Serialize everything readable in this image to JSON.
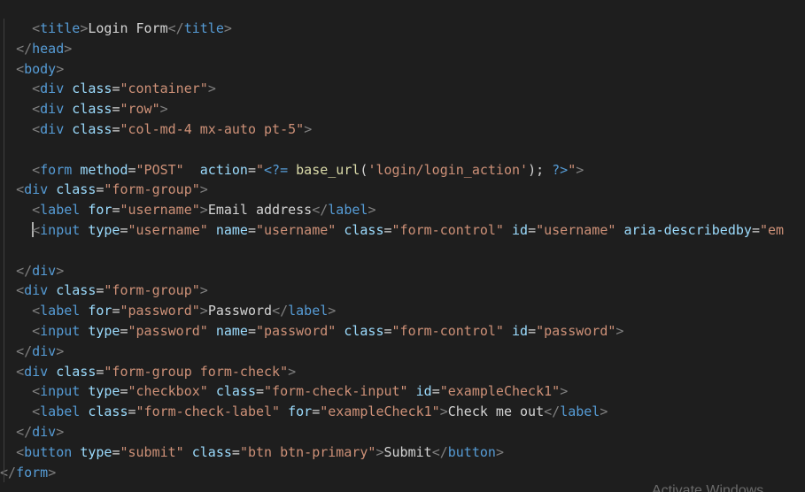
{
  "code_lines": [
    [
      {
        "c": "tk-text",
        "t": "    "
      },
      {
        "c": "tk-punct",
        "t": "<"
      },
      {
        "c": "tk-tag",
        "t": "title"
      },
      {
        "c": "tk-punct",
        "t": ">"
      },
      {
        "c": "tk-text",
        "t": "Login Form"
      },
      {
        "c": "tk-punct",
        "t": "</"
      },
      {
        "c": "tk-tag",
        "t": "title"
      },
      {
        "c": "tk-punct",
        "t": ">"
      }
    ],
    [
      {
        "c": "tk-text",
        "t": "  "
      },
      {
        "c": "tk-punct",
        "t": "</"
      },
      {
        "c": "tk-tag",
        "t": "head"
      },
      {
        "c": "tk-punct",
        "t": ">"
      }
    ],
    [
      {
        "c": "tk-text",
        "t": "  "
      },
      {
        "c": "tk-punct",
        "t": "<"
      },
      {
        "c": "tk-tag",
        "t": "body"
      },
      {
        "c": "tk-punct",
        "t": ">"
      }
    ],
    [
      {
        "c": "tk-text",
        "t": "    "
      },
      {
        "c": "tk-punct",
        "t": "<"
      },
      {
        "c": "tk-tag",
        "t": "div"
      },
      {
        "c": "tk-text",
        "t": " "
      },
      {
        "c": "tk-attr",
        "t": "class"
      },
      {
        "c": "tk-text",
        "t": "="
      },
      {
        "c": "tk-str",
        "t": "\"container\""
      },
      {
        "c": "tk-punct",
        "t": ">"
      }
    ],
    [
      {
        "c": "tk-text",
        "t": "    "
      },
      {
        "c": "tk-punct",
        "t": "<"
      },
      {
        "c": "tk-tag",
        "t": "div"
      },
      {
        "c": "tk-text",
        "t": " "
      },
      {
        "c": "tk-attr",
        "t": "class"
      },
      {
        "c": "tk-text",
        "t": "="
      },
      {
        "c": "tk-str",
        "t": "\"row\""
      },
      {
        "c": "tk-punct",
        "t": ">"
      }
    ],
    [
      {
        "c": "tk-text",
        "t": "    "
      },
      {
        "c": "tk-punct",
        "t": "<"
      },
      {
        "c": "tk-tag",
        "t": "div"
      },
      {
        "c": "tk-text",
        "t": " "
      },
      {
        "c": "tk-attr",
        "t": "class"
      },
      {
        "c": "tk-text",
        "t": "="
      },
      {
        "c": "tk-str",
        "t": "\"col-md-4 mx-auto pt-5\""
      },
      {
        "c": "tk-punct",
        "t": ">"
      }
    ],
    [],
    [
      {
        "c": "tk-text",
        "t": "    "
      },
      {
        "c": "tk-punct",
        "t": "<"
      },
      {
        "c": "tk-tag",
        "t": "form"
      },
      {
        "c": "tk-text",
        "t": " "
      },
      {
        "c": "tk-attr",
        "t": "method"
      },
      {
        "c": "tk-text",
        "t": "="
      },
      {
        "c": "tk-str",
        "t": "\"POST\""
      },
      {
        "c": "tk-text",
        "t": "  "
      },
      {
        "c": "tk-attr",
        "t": "action"
      },
      {
        "c": "tk-text",
        "t": "="
      },
      {
        "c": "tk-str",
        "t": "\""
      },
      {
        "c": "tk-php-delim",
        "t": "<?="
      },
      {
        "c": "tk-text",
        "t": " "
      },
      {
        "c": "tk-func",
        "t": "base_url"
      },
      {
        "c": "tk-text",
        "t": "("
      },
      {
        "c": "tk-str",
        "t": "'login/login_action'"
      },
      {
        "c": "tk-text",
        "t": "); "
      },
      {
        "c": "tk-php-delim",
        "t": "?>"
      },
      {
        "c": "tk-str",
        "t": "\""
      },
      {
        "c": "tk-punct",
        "t": ">"
      }
    ],
    [
      {
        "c": "tk-text",
        "t": "  "
      },
      {
        "c": "tk-punct",
        "t": "<"
      },
      {
        "c": "tk-tag",
        "t": "div"
      },
      {
        "c": "tk-text",
        "t": " "
      },
      {
        "c": "tk-attr",
        "t": "class"
      },
      {
        "c": "tk-text",
        "t": "="
      },
      {
        "c": "tk-str",
        "t": "\"form-group\""
      },
      {
        "c": "tk-punct",
        "t": ">"
      }
    ],
    [
      {
        "c": "tk-text",
        "t": "    "
      },
      {
        "c": "tk-punct",
        "t": "<"
      },
      {
        "c": "tk-tag",
        "t": "label"
      },
      {
        "c": "tk-text",
        "t": " "
      },
      {
        "c": "tk-attr",
        "t": "for"
      },
      {
        "c": "tk-text",
        "t": "="
      },
      {
        "c": "tk-str",
        "t": "\"username\""
      },
      {
        "c": "tk-punct",
        "t": ">"
      },
      {
        "c": "tk-text",
        "t": "Email address"
      },
      {
        "c": "tk-punct",
        "t": "</"
      },
      {
        "c": "tk-tag",
        "t": "label"
      },
      {
        "c": "tk-punct",
        "t": ">"
      }
    ],
    [
      {
        "c": "tk-text",
        "t": "    "
      },
      {
        "c": "cursor",
        "t": ""
      },
      {
        "c": "tk-punct",
        "t": "<"
      },
      {
        "c": "tk-tag",
        "t": "input"
      },
      {
        "c": "tk-text",
        "t": " "
      },
      {
        "c": "tk-attr",
        "t": "type"
      },
      {
        "c": "tk-text",
        "t": "="
      },
      {
        "c": "tk-str",
        "t": "\"username\""
      },
      {
        "c": "tk-text",
        "t": " "
      },
      {
        "c": "tk-attr",
        "t": "name"
      },
      {
        "c": "tk-text",
        "t": "="
      },
      {
        "c": "tk-str",
        "t": "\"username\""
      },
      {
        "c": "tk-text",
        "t": " "
      },
      {
        "c": "tk-attr",
        "t": "class"
      },
      {
        "c": "tk-text",
        "t": "="
      },
      {
        "c": "tk-str",
        "t": "\"form-control\""
      },
      {
        "c": "tk-text",
        "t": " "
      },
      {
        "c": "tk-attr",
        "t": "id"
      },
      {
        "c": "tk-text",
        "t": "="
      },
      {
        "c": "tk-str",
        "t": "\"username\""
      },
      {
        "c": "tk-text",
        "t": " "
      },
      {
        "c": "tk-attr",
        "t": "aria-describedby"
      },
      {
        "c": "tk-text",
        "t": "="
      },
      {
        "c": "tk-str",
        "t": "\"em"
      }
    ],
    [],
    [
      {
        "c": "tk-text",
        "t": "  "
      },
      {
        "c": "tk-punct",
        "t": "</"
      },
      {
        "c": "tk-tag",
        "t": "div"
      },
      {
        "c": "tk-punct",
        "t": ">"
      }
    ],
    [
      {
        "c": "tk-text",
        "t": "  "
      },
      {
        "c": "tk-punct",
        "t": "<"
      },
      {
        "c": "tk-tag",
        "t": "div"
      },
      {
        "c": "tk-text",
        "t": " "
      },
      {
        "c": "tk-attr",
        "t": "class"
      },
      {
        "c": "tk-text",
        "t": "="
      },
      {
        "c": "tk-str",
        "t": "\"form-group\""
      },
      {
        "c": "tk-punct",
        "t": ">"
      }
    ],
    [
      {
        "c": "tk-text",
        "t": "    "
      },
      {
        "c": "tk-punct",
        "t": "<"
      },
      {
        "c": "tk-tag",
        "t": "label"
      },
      {
        "c": "tk-text",
        "t": " "
      },
      {
        "c": "tk-attr",
        "t": "for"
      },
      {
        "c": "tk-text",
        "t": "="
      },
      {
        "c": "tk-str",
        "t": "\"password\""
      },
      {
        "c": "tk-punct",
        "t": ">"
      },
      {
        "c": "tk-text",
        "t": "Password"
      },
      {
        "c": "tk-punct",
        "t": "</"
      },
      {
        "c": "tk-tag",
        "t": "label"
      },
      {
        "c": "tk-punct",
        "t": ">"
      }
    ],
    [
      {
        "c": "tk-text",
        "t": "    "
      },
      {
        "c": "tk-punct",
        "t": "<"
      },
      {
        "c": "tk-tag",
        "t": "input"
      },
      {
        "c": "tk-text",
        "t": " "
      },
      {
        "c": "tk-attr",
        "t": "type"
      },
      {
        "c": "tk-text",
        "t": "="
      },
      {
        "c": "tk-str",
        "t": "\"password\""
      },
      {
        "c": "tk-text",
        "t": " "
      },
      {
        "c": "tk-attr",
        "t": "name"
      },
      {
        "c": "tk-text",
        "t": "="
      },
      {
        "c": "tk-str",
        "t": "\"password\""
      },
      {
        "c": "tk-text",
        "t": " "
      },
      {
        "c": "tk-attr",
        "t": "class"
      },
      {
        "c": "tk-text",
        "t": "="
      },
      {
        "c": "tk-str",
        "t": "\"form-control\""
      },
      {
        "c": "tk-text",
        "t": " "
      },
      {
        "c": "tk-attr",
        "t": "id"
      },
      {
        "c": "tk-text",
        "t": "="
      },
      {
        "c": "tk-str",
        "t": "\"password\""
      },
      {
        "c": "tk-punct",
        "t": ">"
      }
    ],
    [
      {
        "c": "tk-text",
        "t": "  "
      },
      {
        "c": "tk-punct",
        "t": "</"
      },
      {
        "c": "tk-tag",
        "t": "div"
      },
      {
        "c": "tk-punct",
        "t": ">"
      }
    ],
    [
      {
        "c": "tk-text",
        "t": "  "
      },
      {
        "c": "tk-punct",
        "t": "<"
      },
      {
        "c": "tk-tag",
        "t": "div"
      },
      {
        "c": "tk-text",
        "t": " "
      },
      {
        "c": "tk-attr",
        "t": "class"
      },
      {
        "c": "tk-text",
        "t": "="
      },
      {
        "c": "tk-str",
        "t": "\"form-group form-check\""
      },
      {
        "c": "tk-punct",
        "t": ">"
      }
    ],
    [
      {
        "c": "tk-text",
        "t": "    "
      },
      {
        "c": "tk-punct",
        "t": "<"
      },
      {
        "c": "tk-tag",
        "t": "input"
      },
      {
        "c": "tk-text",
        "t": " "
      },
      {
        "c": "tk-attr",
        "t": "type"
      },
      {
        "c": "tk-text",
        "t": "="
      },
      {
        "c": "tk-str",
        "t": "\"checkbox\""
      },
      {
        "c": "tk-text",
        "t": " "
      },
      {
        "c": "tk-attr",
        "t": "class"
      },
      {
        "c": "tk-text",
        "t": "="
      },
      {
        "c": "tk-str",
        "t": "\"form-check-input\""
      },
      {
        "c": "tk-text",
        "t": " "
      },
      {
        "c": "tk-attr",
        "t": "id"
      },
      {
        "c": "tk-text",
        "t": "="
      },
      {
        "c": "tk-str",
        "t": "\"exampleCheck1\""
      },
      {
        "c": "tk-punct",
        "t": ">"
      }
    ],
    [
      {
        "c": "tk-text",
        "t": "    "
      },
      {
        "c": "tk-punct",
        "t": "<"
      },
      {
        "c": "tk-tag",
        "t": "label"
      },
      {
        "c": "tk-text",
        "t": " "
      },
      {
        "c": "tk-attr",
        "t": "class"
      },
      {
        "c": "tk-text",
        "t": "="
      },
      {
        "c": "tk-str",
        "t": "\"form-check-label\""
      },
      {
        "c": "tk-text",
        "t": " "
      },
      {
        "c": "tk-attr",
        "t": "for"
      },
      {
        "c": "tk-text",
        "t": "="
      },
      {
        "c": "tk-str",
        "t": "\"exampleCheck1\""
      },
      {
        "c": "tk-punct",
        "t": ">"
      },
      {
        "c": "tk-text",
        "t": "Check me out"
      },
      {
        "c": "tk-punct",
        "t": "</"
      },
      {
        "c": "tk-tag",
        "t": "label"
      },
      {
        "c": "tk-punct",
        "t": ">"
      }
    ],
    [
      {
        "c": "tk-text",
        "t": "  "
      },
      {
        "c": "tk-punct",
        "t": "</"
      },
      {
        "c": "tk-tag",
        "t": "div"
      },
      {
        "c": "tk-punct",
        "t": ">"
      }
    ],
    [
      {
        "c": "tk-text",
        "t": "  "
      },
      {
        "c": "tk-punct",
        "t": "<"
      },
      {
        "c": "tk-tag",
        "t": "button"
      },
      {
        "c": "tk-text",
        "t": " "
      },
      {
        "c": "tk-attr",
        "t": "type"
      },
      {
        "c": "tk-text",
        "t": "="
      },
      {
        "c": "tk-str",
        "t": "\"submit\""
      },
      {
        "c": "tk-text",
        "t": " "
      },
      {
        "c": "tk-attr",
        "t": "class"
      },
      {
        "c": "tk-text",
        "t": "="
      },
      {
        "c": "tk-str",
        "t": "\"btn btn-primary\""
      },
      {
        "c": "tk-punct",
        "t": ">"
      },
      {
        "c": "tk-text",
        "t": "Submit"
      },
      {
        "c": "tk-punct",
        "t": "</"
      },
      {
        "c": "tk-tag",
        "t": "button"
      },
      {
        "c": "tk-punct",
        "t": ">"
      }
    ],
    [
      {
        "c": "tk-punct",
        "t": "</"
      },
      {
        "c": "tk-tag",
        "t": "form"
      },
      {
        "c": "tk-punct",
        "t": ">"
      }
    ]
  ],
  "watermark": "Activate Windows",
  "colors": {
    "background": "#1e1e1e",
    "tag": "#569cd6",
    "attribute": "#9cdcfe",
    "string": "#ce9178",
    "text": "#d4d4d4",
    "punctuation": "#808080",
    "function": "#dcdcaa"
  }
}
